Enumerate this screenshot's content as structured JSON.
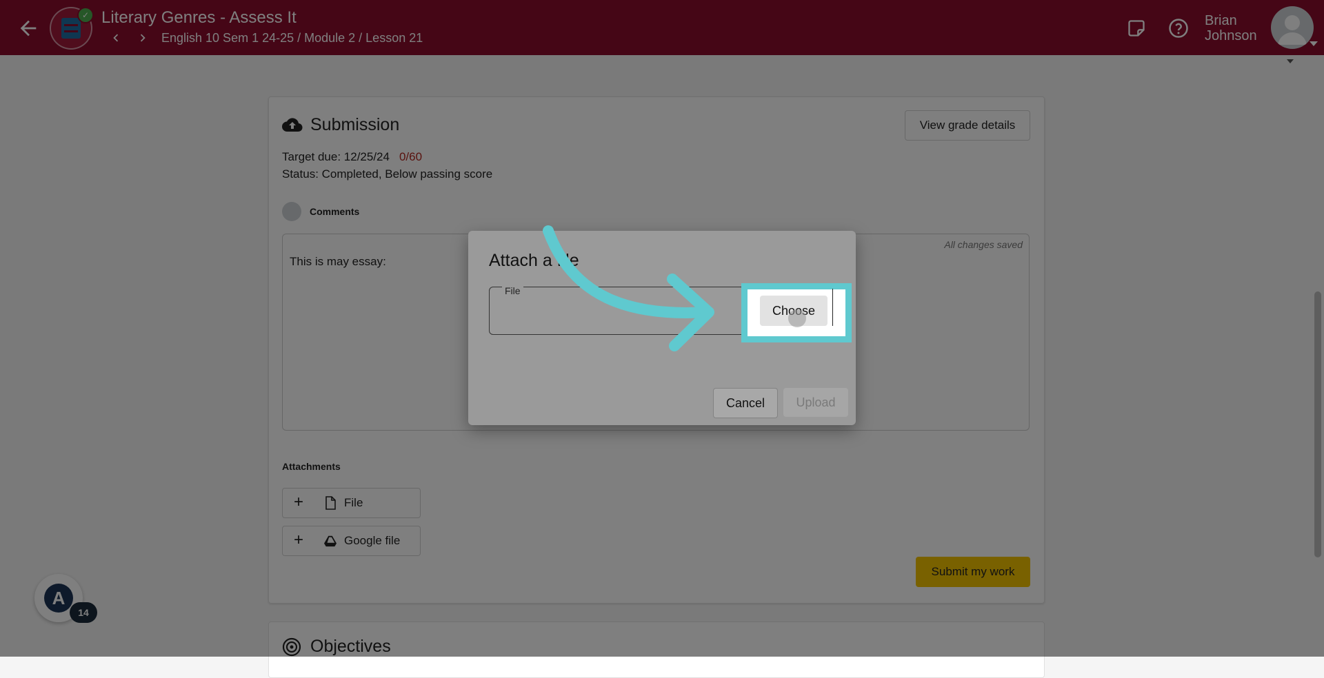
{
  "header": {
    "title": "Literary Genres - Assess It",
    "breadcrumb": "English 10 Sem 1 24-25 / Module 2 / Lesson 21",
    "user_name_first": "Brian",
    "user_name_last": "Johnson",
    "icons": [
      "back-arrow-icon",
      "app-logo-icon",
      "check-icon",
      "chevron-left-icon",
      "chevron-right-icon",
      "notes-icon",
      "help-icon",
      "avatar"
    ]
  },
  "submission": {
    "title": "Submission",
    "view_grade_label": "View grade details",
    "target_due_label": "Target due: 12/25/24",
    "score": "0/60",
    "status": "Status: Completed, Below passing score",
    "comments_label": "Comments",
    "saved_note": "All changes saved",
    "editor_text": "This is may essay:",
    "attachments_label": "Attachments",
    "attach_file_label": "File",
    "attach_google_label": "Google file",
    "submit_label": "Submit my work"
  },
  "objectives": {
    "title": "Objectives"
  },
  "assistant": {
    "badge_count": "14",
    "logo_letter": "A"
  },
  "dialog": {
    "title": "Attach a file",
    "file_field_label": "File",
    "choose_label": "Choose",
    "cancel_label": "Cancel",
    "upload_label": "Upload"
  },
  "colors": {
    "header_bg": "#8a0d2c",
    "score_red": "#b3261e",
    "submit_yellow": "#f3c300",
    "highlight_teal": "#5fc9cf"
  }
}
